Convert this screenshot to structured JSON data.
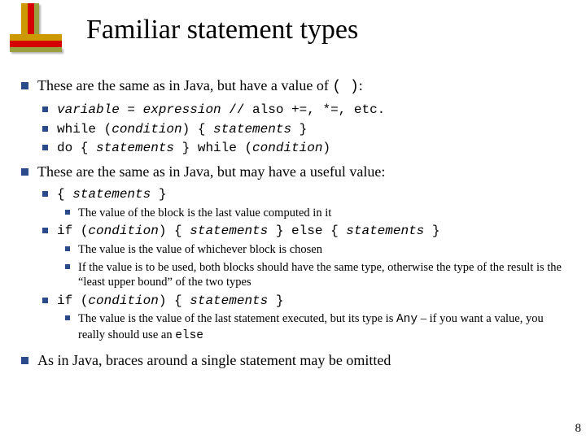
{
  "title": "Familiar statement types",
  "pageNumber": "8",
  "bullets": {
    "a": {
      "text_before": "These are the same as in Java, but have a value of ",
      "code": "( )",
      "text_after": ":"
    },
    "a1": {
      "var": "variable",
      "eq": " = ",
      "expr": "expression",
      "rest": " // also +=, *=, etc."
    },
    "a2": {
      "kw1": "while (",
      "cond": "condition",
      "kw2": ") { ",
      "stmts": "statements",
      "kw3": " }"
    },
    "a3": {
      "kw1": "do { ",
      "stmts": "statements",
      "kw2": " } while (",
      "cond": "condition",
      "kw3": ")"
    },
    "b": "These are the same as in Java, but may have a useful value:",
    "b1": {
      "kw1": "{ ",
      "stmts": "statements",
      "kw2": " }"
    },
    "b1n": "The value of the block is the last value computed in it",
    "b2": {
      "kw1": "if (",
      "cond": "condition",
      "kw2": ") { ",
      "stmts1": "statements",
      "kw3": " } else { ",
      "stmts2": "statements",
      "kw4": " }"
    },
    "b2n1": "The value is the value of whichever block is chosen",
    "b2n2": "If the value is to be used, both blocks should have the same type, otherwise the type of the result is the “least upper bound” of the two types",
    "b3": {
      "kw1": "if (",
      "cond": "condition",
      "kw2": ") { ",
      "stmts": "statements",
      "kw3": " }"
    },
    "b3n_before": "The value is the value of the last statement executed, but its type is ",
    "b3n_code": "Any",
    "b3n_mid": " – if you want a value, you really should use an ",
    "b3n_code2": "else",
    "c": "As in Java, braces around a single statement may be omitted"
  }
}
